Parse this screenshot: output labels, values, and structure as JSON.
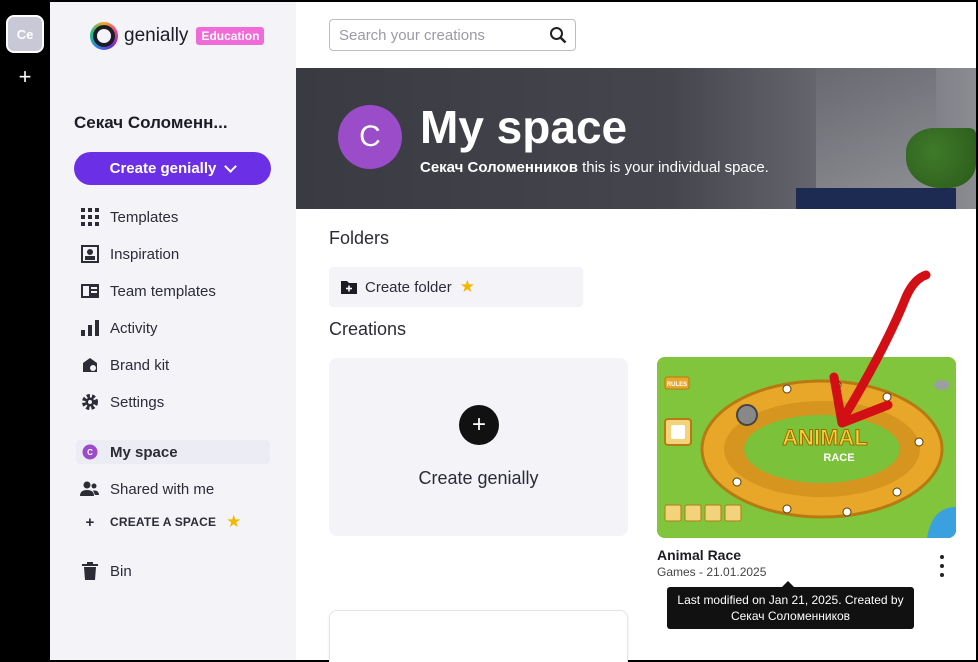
{
  "rail": {
    "workspace_initials": "Ce",
    "add_label": "+"
  },
  "brand": {
    "name": "genially",
    "badge": "Education"
  },
  "sidebar": {
    "user_name": "Секач Соломенн...",
    "create_label": "Create genially",
    "items": [
      {
        "label": "Templates",
        "icon": "grid-icon"
      },
      {
        "label": "Inspiration",
        "icon": "inspiration-icon"
      },
      {
        "label": "Team templates",
        "icon": "team-templates-icon"
      },
      {
        "label": "Activity",
        "icon": "bar-chart-icon"
      },
      {
        "label": "Brand kit",
        "icon": "brand-kit-icon"
      },
      {
        "label": "Settings",
        "icon": "gear-icon"
      }
    ],
    "my_space": {
      "label": "My space",
      "avatar_letter": "C"
    },
    "shared_label": "Shared with me",
    "create_space_label": "CREATE A SPACE",
    "bin_label": "Bin"
  },
  "search": {
    "placeholder": "Search your creations"
  },
  "banner": {
    "avatar_letter": "C",
    "title": "My space",
    "owner": "Секач Соломенников",
    "subtitle_rest": " this is your individual space."
  },
  "folders": {
    "heading": "Folders",
    "create_label": "Create folder"
  },
  "creations": {
    "heading": "Creations",
    "create_label": "Create genially",
    "items": [
      {
        "name": "Animal Race",
        "meta": "Games - 21.01.2025",
        "thumb_title": "ANIMAL",
        "thumb_subtitle": "RACE",
        "thumb_rules": "RULES"
      }
    ]
  },
  "tooltip": {
    "text": "Last modified on Jan 21, 2025. Created by Секач Соломенников"
  },
  "colors": {
    "accent": "#6b2fe6",
    "badge": "#f06ad8",
    "avatar": "#9a4cc9",
    "annotation_arrow": "#d10f14",
    "star": "#f5b800"
  }
}
